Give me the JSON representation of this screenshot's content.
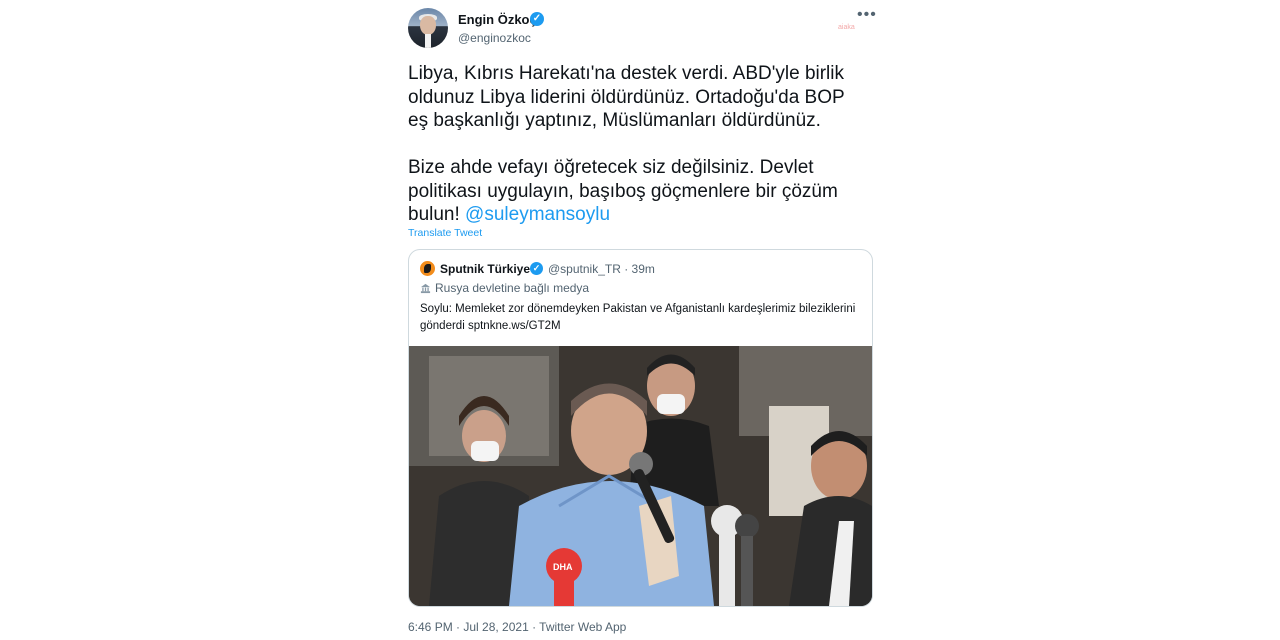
{
  "author": {
    "name": "Engin Özkoç",
    "handle": "@enginozkoc"
  },
  "tweet": {
    "paragraph1": "Libya, Kıbrıs Harekatı'na destek verdi. ABD'yle birlik oldunuz Libya liderini öldürdünüz. Ortadoğu'da BOP eş başkanlığı yaptınız, Müslümanları öldürdünüz.",
    "paragraph2_text": "Bize ahde vefayı öğretecek siz değilsiniz. Devlet politikası uygulayın, başıboş göçmenlere bir çözüm bulun! ",
    "mention": "@suleymansoylu",
    "translate_label": "Translate Tweet",
    "more_icon": "•••",
    "watermark": "aiaka"
  },
  "quote": {
    "name": "Sputnik Türkiye",
    "handle_time": "@sputnik_TR · 39m",
    "label": "Rusya devletine bağlı medya",
    "text": "Soylu: Memleket zor dönemdeyken Pakistan ve Afganistanlı kardeşlerimiz bileziklerini gönderdi sptnkne.ws/GT2M",
    "mic_logo": "DHA"
  },
  "footer": {
    "meta": "6:46 PM · Jul 28, 2021 · Twitter Web App"
  },
  "icons": {
    "verified": "verified-badge-icon",
    "more": "more-options-icon",
    "state_media": "state-media-flag-icon",
    "sputnik_logo": "sputnik-logo-icon"
  },
  "colors": {
    "link": "#1d9bf0",
    "secondary_text": "#536471",
    "border": "#cfd9de",
    "primary_text": "#0f1419"
  }
}
